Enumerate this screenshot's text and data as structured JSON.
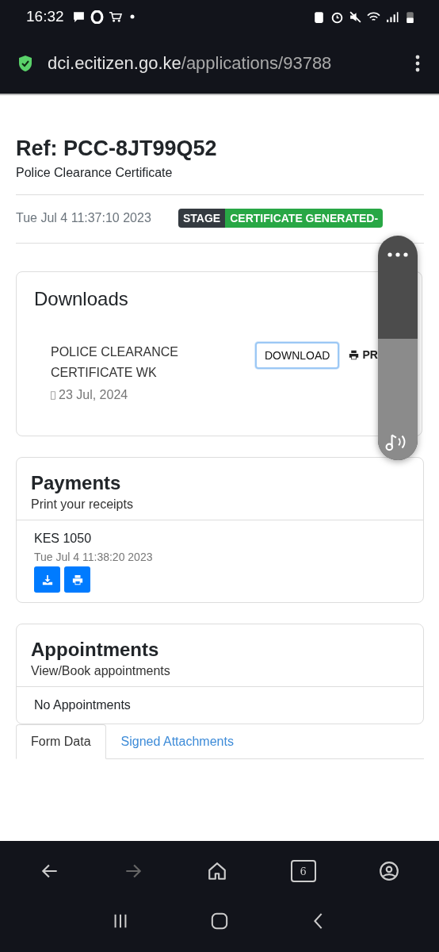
{
  "status_bar": {
    "time": "16:32"
  },
  "browser": {
    "url_host": "dci.ecitizen.go.ke",
    "url_path": "/applications/93788"
  },
  "header": {
    "title": "Ref: PCC-8JT99Q52",
    "subtitle": "Police Clearance Certificate"
  },
  "meta": {
    "date": "Tue Jul 4 11:37:10 2023",
    "stage_label": "STAGE",
    "stage_value": "CERTIFICATE GENERATED-"
  },
  "downloads": {
    "title": "Downloads",
    "item": {
      "name": "POLICE CLEARANCE CERTIFICATE WK",
      "date": "23 Jul, 2024",
      "download_button": "DOWNLOAD",
      "print_button": "PR"
    }
  },
  "payments": {
    "title": "Payments",
    "subtitle": "Print your receipts",
    "amount": "KES 1050",
    "date": "Tue Jul 4 11:38:20 2023"
  },
  "appointments": {
    "title": "Appointments",
    "subtitle": "View/Book appointments",
    "empty": "No Appointments"
  },
  "tabs": [
    {
      "label": "Form Data",
      "selected": true
    },
    {
      "label": "Signed Attachments",
      "selected": false
    }
  ],
  "volume_panel": {
    "level": 0.54
  },
  "bottom_toolbar": {
    "forward_disabled": true,
    "tab_count": "6"
  }
}
